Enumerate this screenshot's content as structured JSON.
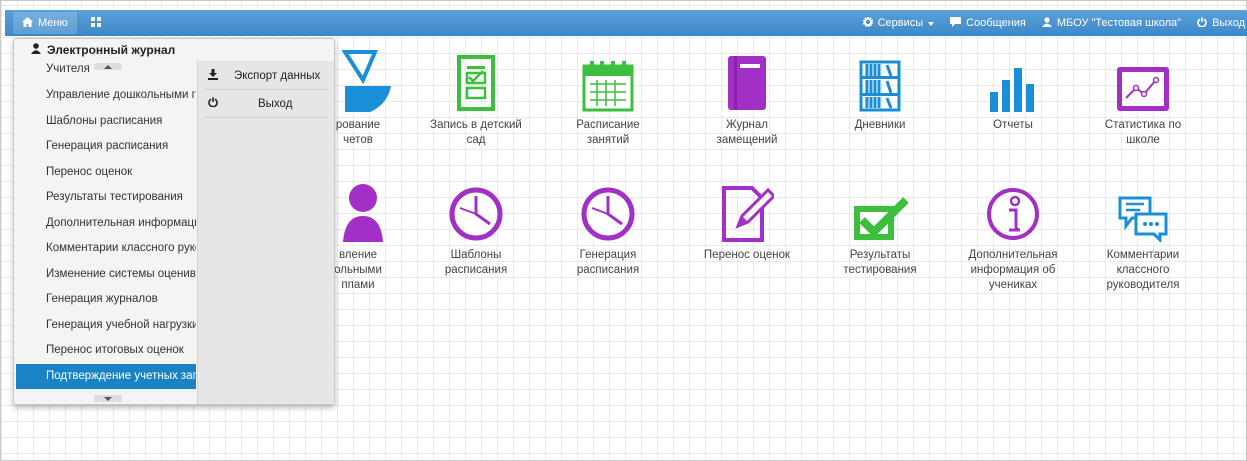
{
  "navbar": {
    "menu_label": "Меню",
    "services_label": "Сервисы",
    "messages_label": "Сообщения",
    "school_label": "МБОУ \"Тестовая школа\"",
    "logout_label": "Выход"
  },
  "dropdown": {
    "header": "Электронный журнал",
    "items": [
      "Учителя",
      "Управление дошкольными группами",
      "Шаблоны расписания",
      "Генерация расписания",
      "Перенос оценок",
      "Результаты тестирования",
      "Дополнительная информация об учениках",
      "Комментарии классного руководителя",
      "Изменение системы оценивания",
      "Генерация журналов",
      "Генерация учебной нагрузки",
      "Перенос итоговых оценок",
      "Подтверждение учетных записей"
    ],
    "active_index": 12,
    "side": {
      "export_label": "Экспорт данных",
      "logout_label": "Выход"
    }
  },
  "tiles_row1": [
    {
      "line1": "рование",
      "line2": "четов"
    },
    {
      "line1": "Запись в детский",
      "line2": "сад"
    },
    {
      "line1": "Расписание",
      "line2": "занятий"
    },
    {
      "line1": "Журнал",
      "line2": "замещений"
    },
    {
      "line1": "Дневники",
      "line2": ""
    },
    {
      "line1": "Отчеты",
      "line2": ""
    },
    {
      "line1": "Статистика по",
      "line2": "школе"
    }
  ],
  "tiles_row2": [
    {
      "line1": "вление",
      "line2": "ольными",
      "line3": "ппами"
    },
    {
      "line1": "Шаблоны",
      "line2": "расписания",
      "line3": ""
    },
    {
      "line1": "Генерация",
      "line2": "расписания",
      "line3": ""
    },
    {
      "line1": "Перенос оценок",
      "line2": "",
      "line3": ""
    },
    {
      "line1": "Результаты",
      "line2": "тестирования",
      "line3": ""
    },
    {
      "line1": "Дополнительная",
      "line2": "информация об",
      "line3": "учениках"
    },
    {
      "line1": "Комментарии",
      "line2": "классного",
      "line3": "руководителя"
    }
  ],
  "colors": {
    "navbar": "#4a94d0",
    "blue_icon": "#1a8fd8",
    "green_icon": "#3cbf3c",
    "purple_icon": "#a22fc6",
    "active_item": "#1a83c6"
  }
}
